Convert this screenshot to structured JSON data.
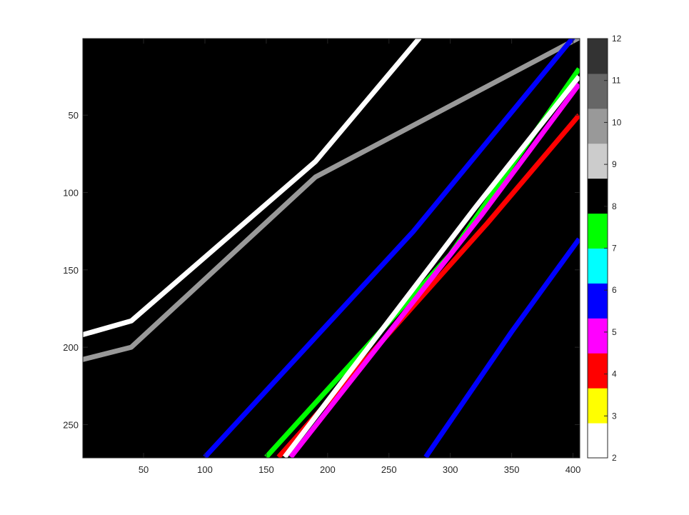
{
  "chart_data": {
    "type": "heatmap",
    "title": "",
    "xlabel": "",
    "ylabel": "",
    "image_size": {
      "cols": 405,
      "rows": 271
    },
    "xlim": [
      0.5,
      405.5
    ],
    "ylim": [
      0.5,
      271.5
    ],
    "y_reversed": true,
    "x_ticks": [
      50,
      100,
      150,
      200,
      250,
      300,
      350,
      400
    ],
    "y_ticks": [
      50,
      100,
      150,
      200,
      250
    ],
    "colorbar": {
      "levels": [
        2,
        3,
        4,
        5,
        6,
        7,
        8,
        9,
        10,
        11,
        12
      ],
      "ticks": [
        2,
        3,
        4,
        5,
        6,
        7,
        8,
        9,
        10,
        11,
        12
      ],
      "colors": [
        "#ffffff",
        "#ffff00",
        "#ff0000",
        "#ff00ff",
        "#0000ff",
        "#00ffff",
        "#00ff00",
        "#000000",
        "#cccccc",
        "#999999",
        "#666666",
        "#333333"
      ]
    },
    "background_color": "#000000",
    "series": [
      {
        "name": "",
        "level": 10,
        "color": "#999999",
        "points": [
          [
            0,
            208
          ],
          [
            40,
            200
          ],
          [
            190,
            90
          ],
          [
            405,
            0
          ]
        ]
      },
      {
        "name": "",
        "level": 2,
        "color": "#ffffff",
        "points": [
          [
            0,
            192
          ],
          [
            40,
            183
          ],
          [
            190,
            80
          ],
          [
            275,
            0
          ]
        ]
      },
      {
        "name": "",
        "level": 6,
        "color": "#0000ff",
        "points": [
          [
            100,
            271
          ],
          [
            270,
            125
          ],
          [
            400,
            0
          ]
        ]
      },
      {
        "name": "",
        "level": 7,
        "color": "#00ff00",
        "points": [
          [
            150,
            271
          ],
          [
            300,
            140
          ],
          [
            405,
            20
          ]
        ]
      },
      {
        "name": "",
        "level": 4,
        "color": "#ff0000",
        "points": [
          [
            160,
            271
          ],
          [
            330,
            120
          ],
          [
            405,
            50
          ]
        ]
      },
      {
        "name": "",
        "level": 2,
        "color": "#ffffff",
        "points": [
          [
            165,
            271
          ],
          [
            320,
            110
          ],
          [
            405,
            25
          ]
        ]
      },
      {
        "name": "",
        "level": 5,
        "color": "#ff00ff",
        "points": [
          [
            170,
            271
          ],
          [
            325,
            115
          ],
          [
            405,
            30
          ]
        ]
      },
      {
        "name": "",
        "level": 6,
        "color": "#0000ff",
        "points": [
          [
            280,
            271
          ],
          [
            350,
            190
          ],
          [
            405,
            130
          ]
        ]
      }
    ]
  }
}
